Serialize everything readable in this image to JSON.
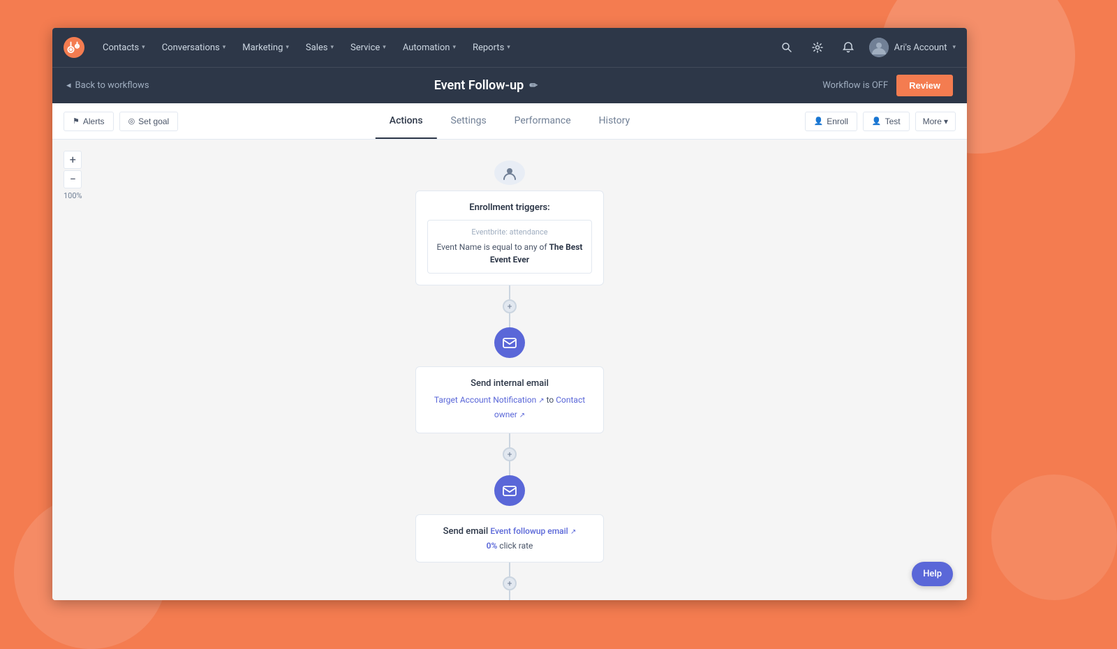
{
  "app": {
    "title": "Event Follow-up",
    "workflow_status": "Workflow is OFF"
  },
  "nav": {
    "logo_alt": "HubSpot logo",
    "items": [
      {
        "label": "Contacts",
        "has_dropdown": true
      },
      {
        "label": "Conversations",
        "has_dropdown": true
      },
      {
        "label": "Marketing",
        "has_dropdown": true
      },
      {
        "label": "Sales",
        "has_dropdown": true
      },
      {
        "label": "Service",
        "has_dropdown": true
      },
      {
        "label": "Automation",
        "has_dropdown": true
      },
      {
        "label": "Reports",
        "has_dropdown": true
      }
    ],
    "account_name": "Ari's Account"
  },
  "breadcrumb": {
    "back_label": "Back to workflows"
  },
  "toolbar": {
    "alerts_label": "Alerts",
    "set_goal_label": "Set goal",
    "tabs": [
      {
        "label": "Actions",
        "active": true
      },
      {
        "label": "Settings",
        "active": false
      },
      {
        "label": "Performance",
        "active": false
      },
      {
        "label": "History",
        "active": false
      }
    ],
    "enroll_label": "Enroll",
    "test_label": "Test",
    "more_label": "More",
    "review_label": "Review"
  },
  "zoom": {
    "level": "100%",
    "plus": "+",
    "minus": "−"
  },
  "nodes": {
    "trigger": {
      "title": "Enrollment triggers:",
      "condition_source": "Eventbrite: attendance",
      "condition_text": "Event Name is equal to any of",
      "condition_value": "The Best Event Ever"
    },
    "action1": {
      "title": "Send internal email",
      "link1_text": "Target Account Notification",
      "to_text": "to",
      "link2_text": "Contact owner"
    },
    "action2": {
      "title": "Send email",
      "link_text": "Event followup email",
      "stat_value": "0%",
      "stat_suffix": "click rate"
    }
  },
  "help": {
    "label": "Help"
  }
}
